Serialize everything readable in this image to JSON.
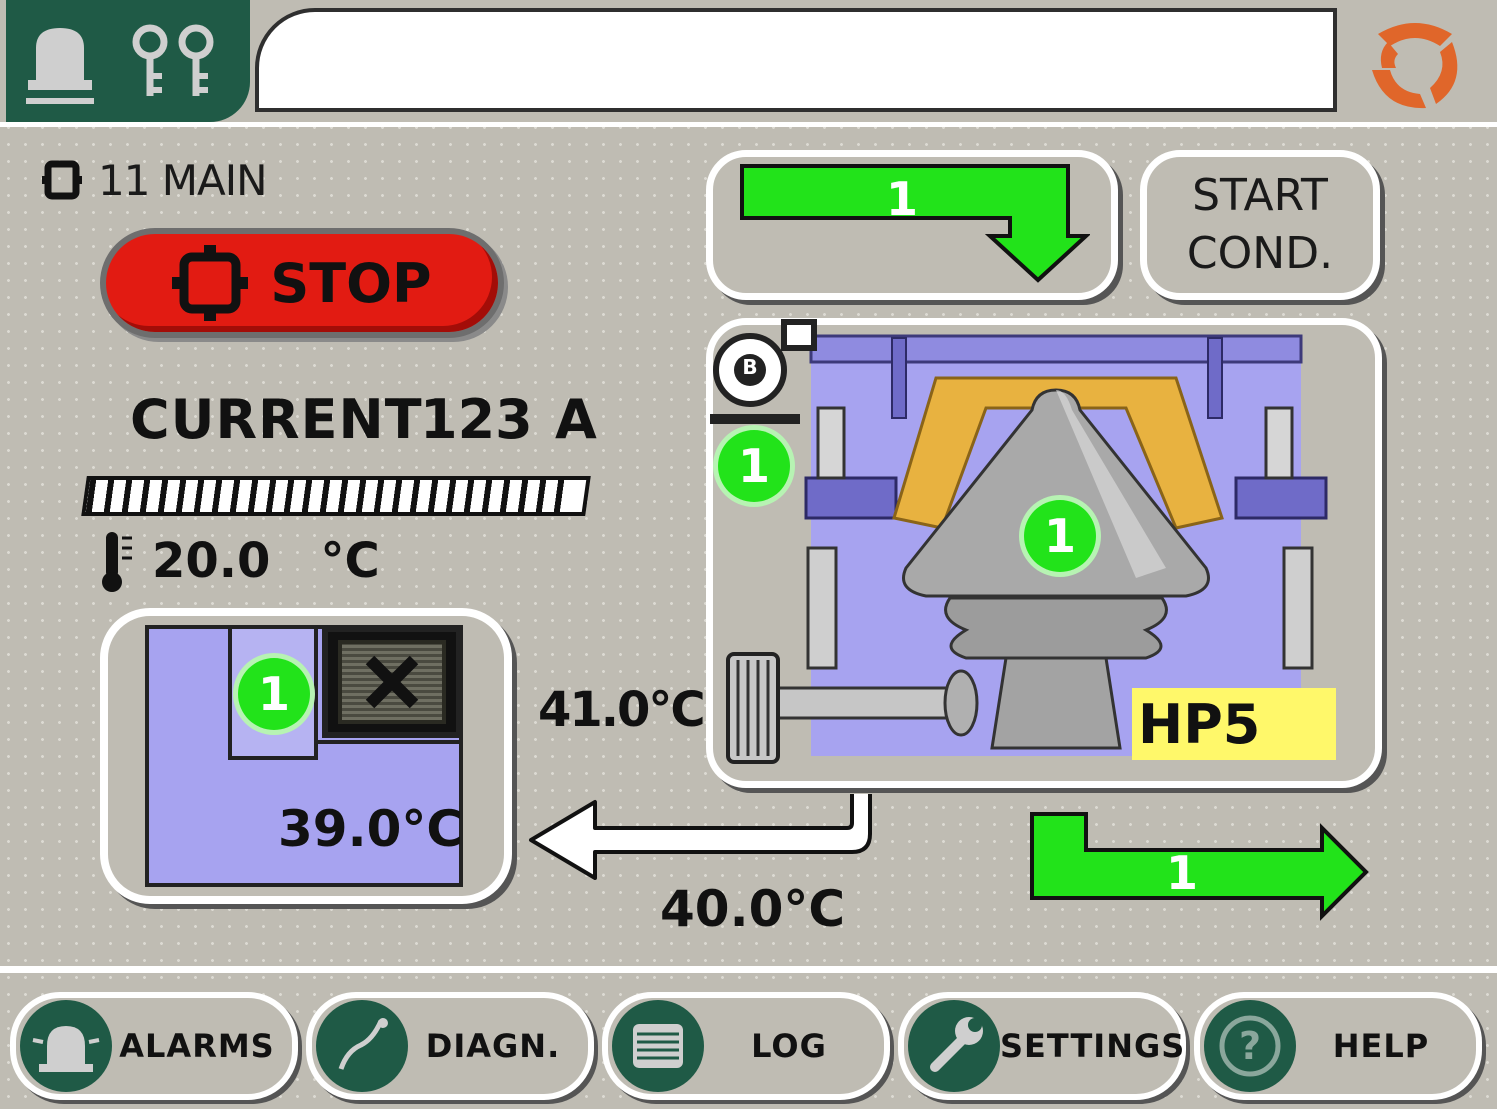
{
  "header": {
    "alarm_tab_icon": "alarm-bell-icon",
    "service_tab_icon": "service-keys-icon",
    "message": "",
    "logo_icon": "brand-logo"
  },
  "status": {
    "mode_label": "11 MAIN",
    "stop_label": "STOP",
    "current_label": "CURRENT",
    "current_value": "123",
    "current_unit": "A",
    "current_level": 0.96,
    "oil_temp_value": "20.0",
    "oil_temp_unit": "°C"
  },
  "lubrication": {
    "tank_temp": "39.0°C",
    "supply_temp": "41.0°C",
    "return_temp": "40.0°C",
    "tank_badge": "1"
  },
  "feed": {
    "badge": "1"
  },
  "start_cond": {
    "line1": "START",
    "line2": "COND."
  },
  "crusher": {
    "model": "HP5",
    "motor_badge": "1",
    "cone_badge": "1",
    "discharge_badge": "1",
    "motor_symbol": "B"
  },
  "nav": {
    "alarms": "ALARMS",
    "diagn": "DIAGN.",
    "log": "LOG",
    "settings": "SETTINGS",
    "help": "HELP"
  },
  "colors": {
    "accent_green": "#22e31a",
    "stop_red": "#e21b12",
    "tank_blue": "#a7a3f0",
    "nav_dark_green": "#1f5a46",
    "model_yellow": "#fff86a"
  }
}
